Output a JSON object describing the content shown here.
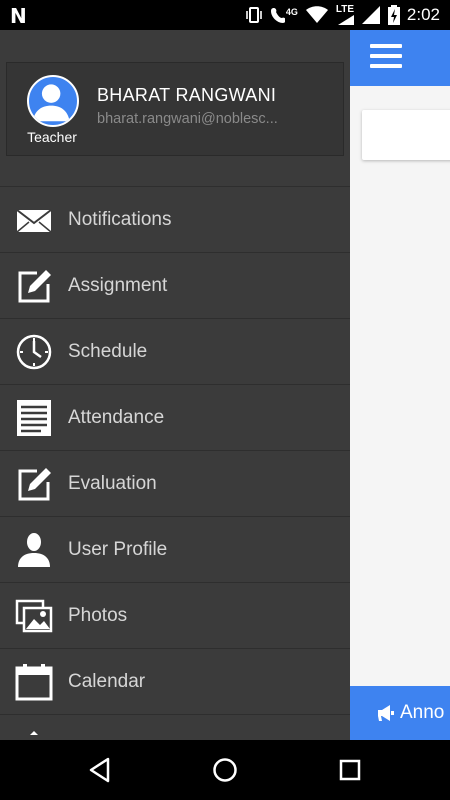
{
  "status_bar": {
    "time": "2:02",
    "network": "LTE",
    "network_small": "4G",
    "icons": [
      "n-notification-icon",
      "vibrate-icon",
      "call-4g-icon",
      "wifi-icon",
      "signal-icon",
      "battery-charging-icon"
    ]
  },
  "drawer": {
    "user": {
      "name": "BHARAT RANGWANI",
      "email": "bharat.rangwani@noblesc...",
      "role": "Teacher"
    },
    "items": [
      {
        "label": "Notifications",
        "icon": "envelope-icon"
      },
      {
        "label": "Assignment",
        "icon": "edit-icon"
      },
      {
        "label": "Schedule",
        "icon": "clock-icon"
      },
      {
        "label": "Attendance",
        "icon": "list-icon"
      },
      {
        "label": "Evaluation",
        "icon": "edit-icon"
      },
      {
        "label": "User Profile",
        "icon": "user-icon"
      },
      {
        "label": "Photos",
        "icon": "photos-icon"
      },
      {
        "label": "Calendar",
        "icon": "calendar-icon"
      }
    ]
  },
  "main": {
    "bottom_label": "Anno"
  },
  "colors": {
    "accent": "#3e83f0",
    "drawer_bg": "#3b3b3b"
  }
}
